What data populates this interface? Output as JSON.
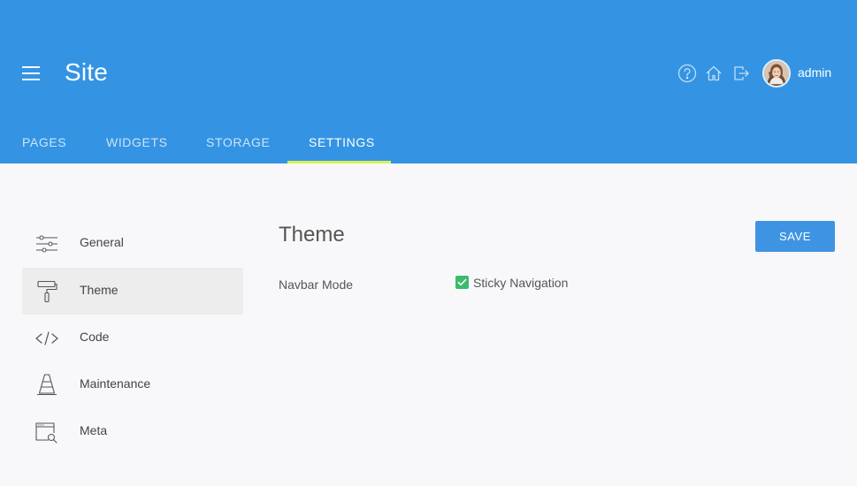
{
  "colors": {
    "header_bg": "#3494e3",
    "active_tab_underline": "#d8f15a",
    "save_button": "#3e94e2",
    "checkbox": "#3cbb6d",
    "sidebar_active_bg": "#ededed"
  },
  "header": {
    "title": "Site",
    "menu_icon": "hamburger-icon",
    "actions": [
      "help-icon",
      "home-icon",
      "logout-icon"
    ],
    "user": {
      "name": "admin",
      "avatar": "avatar"
    }
  },
  "tabs": [
    {
      "label": "PAGES",
      "active": false
    },
    {
      "label": "WIDGETS",
      "active": false
    },
    {
      "label": "STORAGE",
      "active": false
    },
    {
      "label": "SETTINGS",
      "active": true
    }
  ],
  "sidebar": {
    "items": [
      {
        "label": "General",
        "icon": "sliders-icon",
        "active": false
      },
      {
        "label": "Theme",
        "icon": "paint-roller-icon",
        "active": true
      },
      {
        "label": "Code",
        "icon": "code-icon",
        "active": false
      },
      {
        "label": "Maintenance",
        "icon": "traffic-cone-icon",
        "active": false
      },
      {
        "label": "Meta",
        "icon": "browser-search-icon",
        "active": false
      }
    ]
  },
  "main": {
    "title": "Theme",
    "save_label": "SAVE",
    "fields": [
      {
        "label": "Navbar Mode",
        "option_label": "Sticky Navigation",
        "checked": true
      }
    ]
  }
}
